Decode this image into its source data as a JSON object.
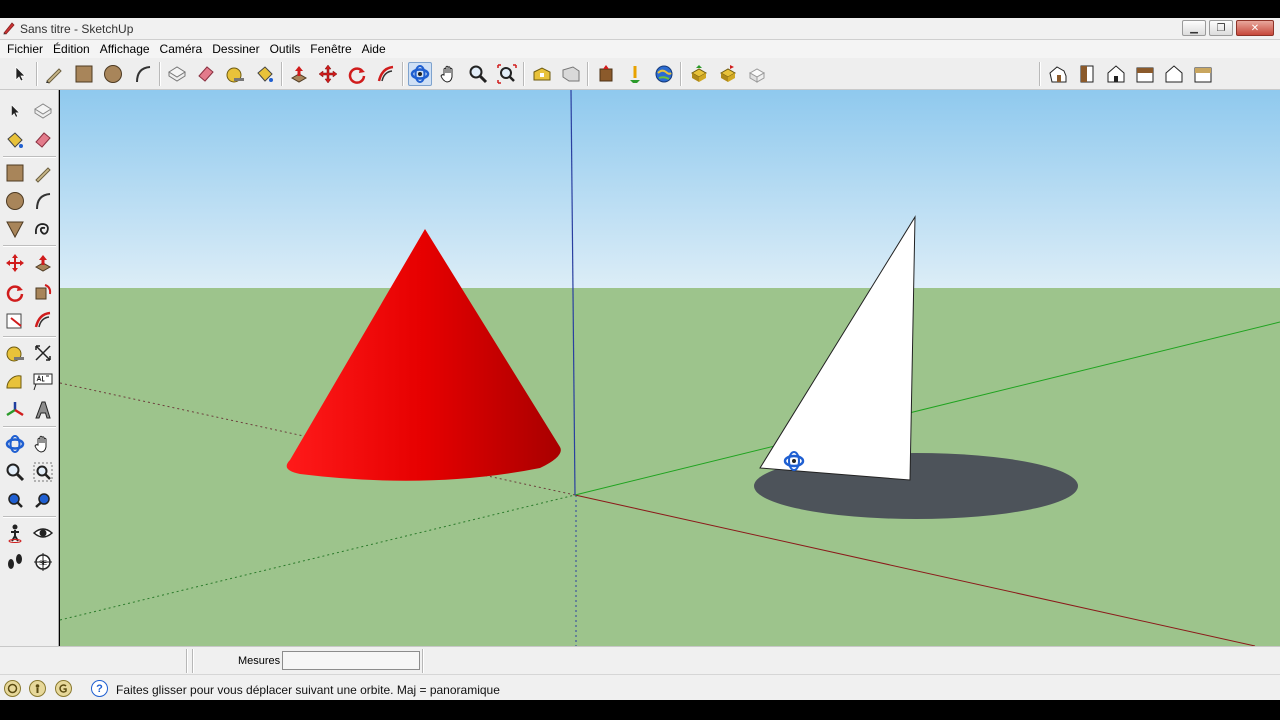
{
  "window": {
    "title": "Sans titre - SketchUp",
    "controls": {
      "minimize": "▁",
      "restore": "❐",
      "close": "✕"
    }
  },
  "menu": [
    "Fichier",
    "Édition",
    "Affichage",
    "Caméra",
    "Dessiner",
    "Outils",
    "Fenêtre",
    "Aide"
  ],
  "toolbar": {
    "active_tool": "orbit",
    "tools": [
      "select",
      "pencil",
      "rectangle",
      "circle",
      "arc",
      "make-component",
      "eraser",
      "tape-measure",
      "paint-bucket",
      "push-pull",
      "move",
      "rotate",
      "follow-me",
      "orbit",
      "pan",
      "zoom",
      "zoom-extents",
      "previous-view",
      "next-view",
      "3d-warehouse",
      "share-model",
      "get-models",
      "google-earth",
      "components",
      "dynamic-component",
      "styles",
      "iso-view",
      "top-view",
      "front-view",
      "right-view",
      "back-view",
      "left-view"
    ]
  },
  "left_tools": [
    "select",
    "make-component",
    "paint-bucket",
    "eraser",
    "rectangle",
    "line",
    "circle",
    "arc",
    "polygon",
    "freehand",
    "move",
    "push-pull",
    "rotate",
    "follow-me",
    "scale",
    "offset",
    "tape-measure",
    "dimension",
    "protractor",
    "text",
    "axes",
    "3d-text",
    "orbit",
    "pan",
    "zoom",
    "zoom-window",
    "zoom-extents",
    "previous",
    "position-camera",
    "look-around",
    "walk",
    "section-plane"
  ],
  "scene": {
    "sky_top": "#8fc9ee",
    "sky_bottom": "#dcedf7",
    "ground": "#9dc48c",
    "cone_color": "#e60000",
    "sail_color": "#ffffff",
    "shadow_color": "#4d535a",
    "axis_red": "#8b1a1a",
    "axis_green": "#1fa31f",
    "axis_blue": "#2a3fa0"
  },
  "measure": {
    "label": "Mesures",
    "value": ""
  },
  "status": {
    "message": "Faites glisser pour vous déplacer suivant une orbite.  Maj = panoramique",
    "help_glyph": "?"
  }
}
